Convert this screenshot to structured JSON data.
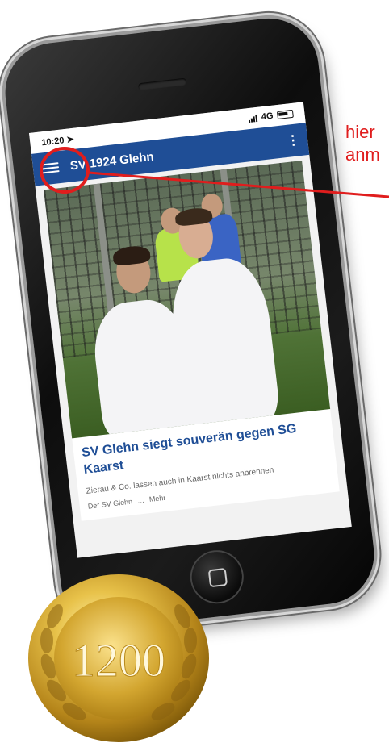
{
  "status_bar": {
    "time": "10:20",
    "network": "4G"
  },
  "app_bar": {
    "title": "SV 1924 Glehn",
    "menu_icon": "hamburger-icon",
    "more_icon": "kebab-icon"
  },
  "article": {
    "headline": "SV Glehn siegt souverän gegen SG Kaarst",
    "teaser": "Zierau & Co. lassen auch in Kaarst nichts anbrennen",
    "author": "Der SV Glehn",
    "more_label": "Mehr"
  },
  "annotation": {
    "line1": "hier",
    "line2": "anm",
    "color": "#e01d1d"
  },
  "medal": {
    "value": "1200"
  },
  "colors": {
    "app_bar": "#1f4e96",
    "headline": "#1f4e96",
    "medal_gold": "#d9a925"
  }
}
